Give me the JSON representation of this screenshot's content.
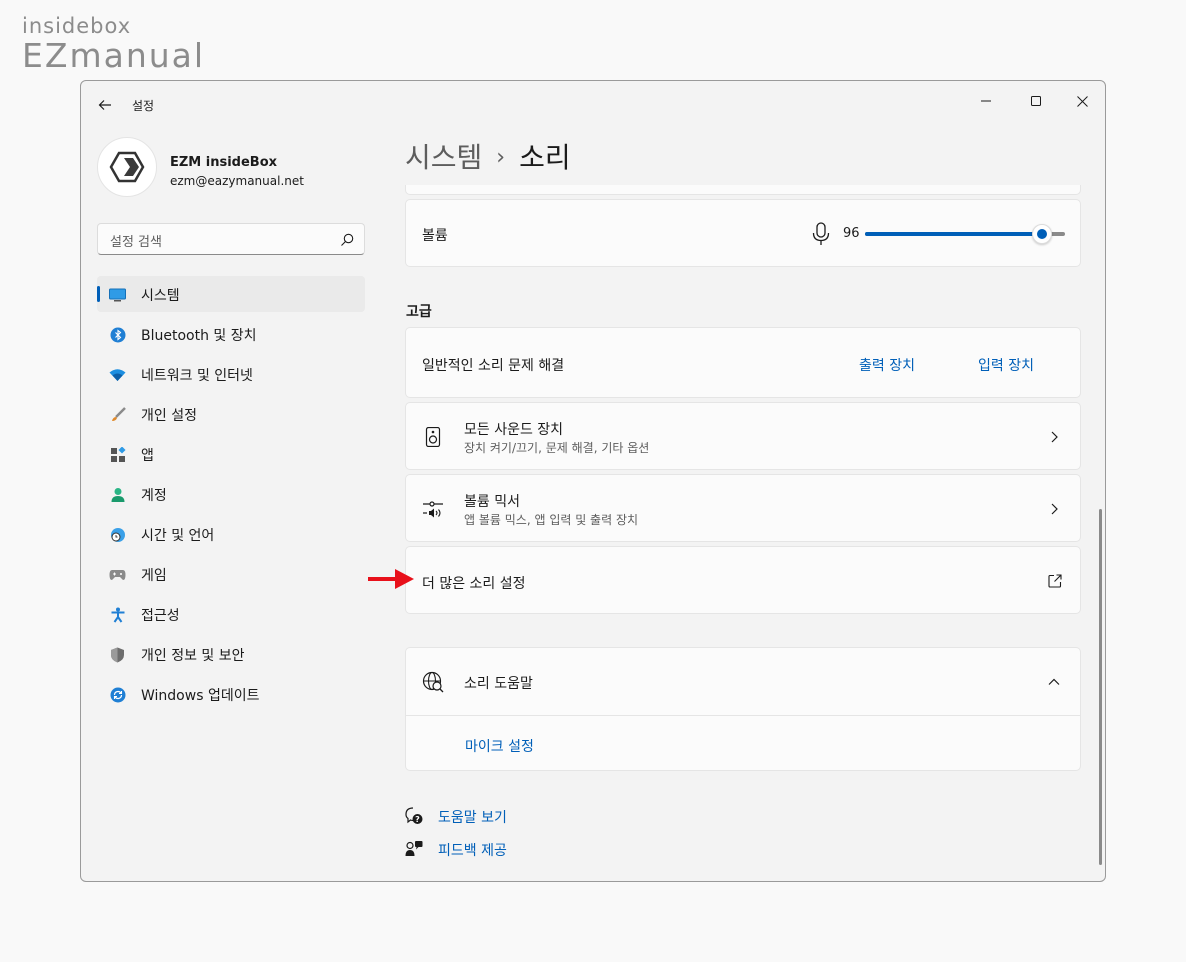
{
  "watermark": {
    "top": "insidebox",
    "bottom": "EZmanual"
  },
  "window": {
    "title": "설정",
    "controls": [
      "minimize-icon",
      "maximize-icon",
      "close-icon"
    ]
  },
  "profile": {
    "name": "EZM insideBox",
    "email": "ezm@eazymanual.net"
  },
  "search": {
    "placeholder": "설정 검색"
  },
  "nav": {
    "items": [
      {
        "label": "시스템",
        "icon": "monitor-icon",
        "selected": true
      },
      {
        "label": "Bluetooth 및 장치",
        "icon": "bluetooth-icon"
      },
      {
        "label": "네트워크 및 인터넷",
        "icon": "wifi-icon"
      },
      {
        "label": "개인 설정",
        "icon": "brush-icon"
      },
      {
        "label": "앱",
        "icon": "apps-icon"
      },
      {
        "label": "계정",
        "icon": "person-icon"
      },
      {
        "label": "시간 및 언어",
        "icon": "globe-clock-icon"
      },
      {
        "label": "게임",
        "icon": "gamepad-icon"
      },
      {
        "label": "접근성",
        "icon": "accessibility-icon"
      },
      {
        "label": "개인 정보 및 보안",
        "icon": "shield-icon"
      },
      {
        "label": "Windows 업데이트",
        "icon": "update-icon"
      }
    ]
  },
  "breadcrumb": {
    "parent": "시스템",
    "separator": "›",
    "current": "소리"
  },
  "volume": {
    "label": "볼륨",
    "value": "96",
    "level": 0.96
  },
  "advanced": {
    "heading": "고급",
    "troubleshoot": {
      "label": "일반적인 소리 문제 해결",
      "output_link": "출력 장치",
      "input_link": "입력 장치"
    },
    "all_devices": {
      "title": "모든 사운드 장치",
      "subtitle": "장치 켜기/끄기, 문제 해결, 기타 옵션"
    },
    "mixer": {
      "title": "볼륨 믹서",
      "subtitle": "앱 볼륨 믹스, 앱 입력 및 출력 장치"
    },
    "more": {
      "title": "더 많은 소리 설정"
    }
  },
  "help": {
    "title": "소리 도움말",
    "link": "마이크 설정"
  },
  "footer": {
    "get_help": "도움말 보기",
    "feedback": "피드백 제공"
  },
  "colors": {
    "accent": "#005fb8",
    "arrow": "#e8101a"
  }
}
